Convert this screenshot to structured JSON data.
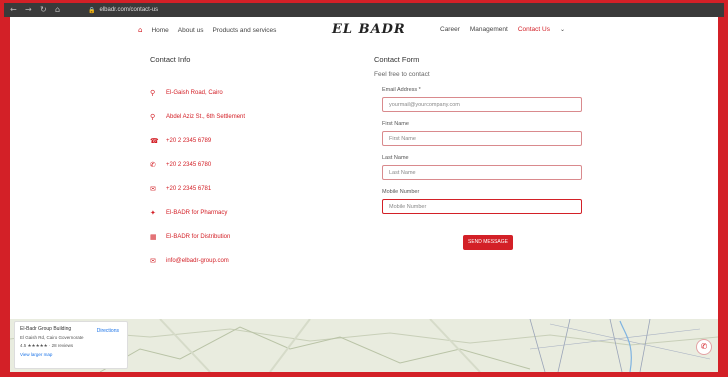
{
  "browser": {
    "url": "elbadr.com/contact-us",
    "back_icon": "←",
    "forward_icon": "→",
    "reload_icon": "↻",
    "home_icon": "⌂",
    "lock_icon": "🔒"
  },
  "nav": {
    "home_icon": "⌂",
    "left_items": [
      "Home",
      "About us",
      "Products and services"
    ],
    "logo": "EL BADR",
    "right_items": [
      "Career",
      "Management",
      "Contact Us"
    ],
    "active_item": "Contact Us",
    "more_icon": "⌄"
  },
  "contact_info": {
    "title": "Contact Info",
    "items": [
      {
        "icon": "⚲",
        "text": "El-Gaish Road, Cairo"
      },
      {
        "icon": "⚲",
        "text": "Abdel Aziz St., 6th Settlement"
      },
      {
        "icon": "☎",
        "text": "+20 2 2345 6789"
      },
      {
        "icon": "✆",
        "text": "+20 2 2345 6780"
      },
      {
        "icon": "✉",
        "text": "+20 2 2345 6781"
      },
      {
        "icon": "✦",
        "text": "El-BADR for Pharmacy"
      },
      {
        "icon": "▦",
        "text": "El-BADR for Distribution"
      },
      {
        "icon": "✉",
        "text": "info@elbadr-group.com"
      }
    ]
  },
  "contact_form": {
    "title": "Contact Form",
    "subtitle": "Feel free to contact",
    "fields": [
      {
        "label": "Email Address *",
        "value": "yourmail@yourcompany.com"
      },
      {
        "label": "First Name",
        "value": "First Name"
      },
      {
        "label": "Last Name",
        "value": "Last Name"
      },
      {
        "label": "Mobile Number",
        "value": "Mobile Number"
      }
    ],
    "submit_label": "SEND MESSAGE"
  },
  "map": {
    "place_title": "El-Badr Group Building",
    "address": "El Gaish Rd, Cairo Governorate",
    "directions_label": "Directions",
    "rating": "4.5 ★★★★★ · 28 reviews",
    "view_larger": "View larger map",
    "chat_icon": "✆"
  },
  "colors": {
    "accent": "#d32027",
    "text": "#333333"
  }
}
